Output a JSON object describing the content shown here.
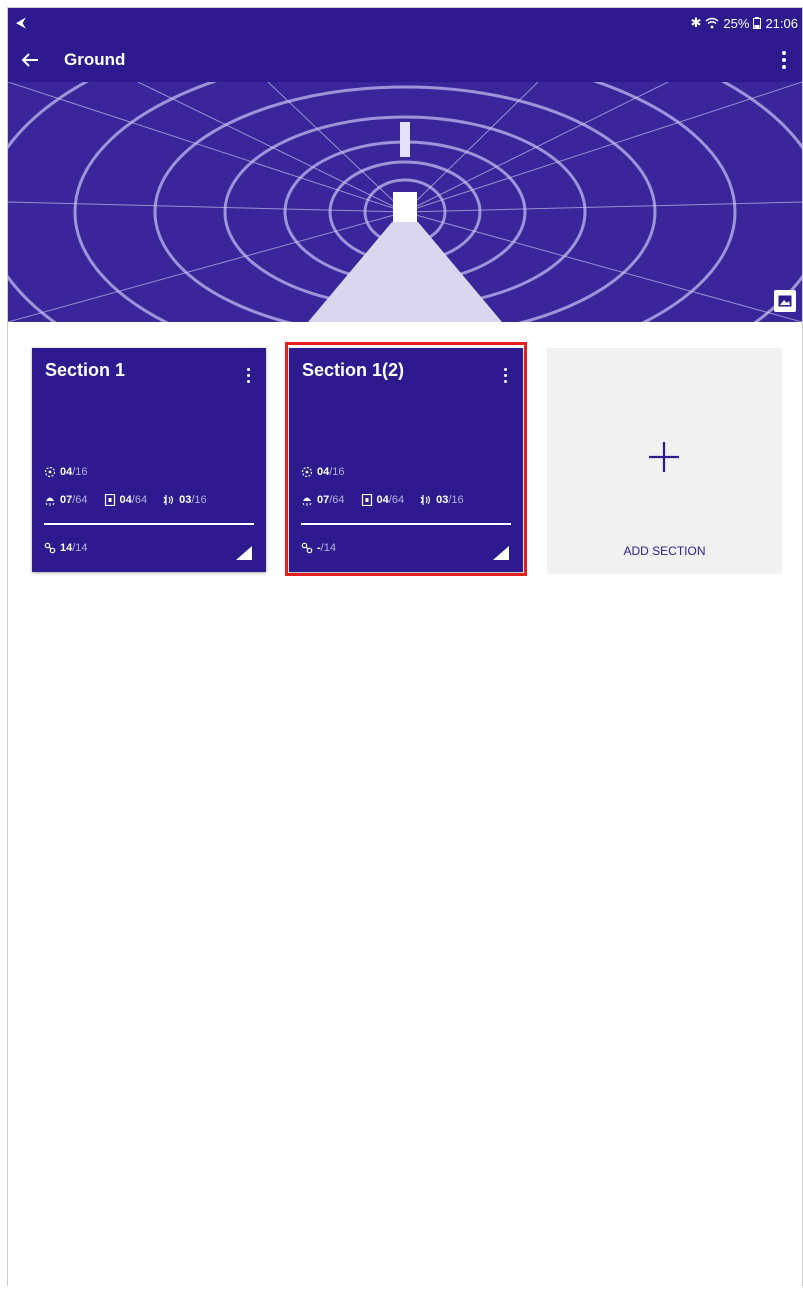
{
  "status_bar": {
    "battery": "25%",
    "time": "21:06"
  },
  "app_bar": {
    "title": "Ground"
  },
  "sections": [
    {
      "title": "Section 1",
      "sensor": {
        "value": "04",
        "total": "/16"
      },
      "sirens": {
        "value": "07",
        "total": "/64"
      },
      "keypads": {
        "value": "04",
        "total": "/64"
      },
      "repeaters": {
        "value": "03",
        "total": "/16"
      },
      "links": {
        "value": "14",
        "total": "/14"
      }
    },
    {
      "title": "Section 1(2)",
      "sensor": {
        "value": "04",
        "total": "/16"
      },
      "sirens": {
        "value": "07",
        "total": "/64"
      },
      "keypads": {
        "value": "04",
        "total": "/64"
      },
      "repeaters": {
        "value": "03",
        "total": "/16"
      },
      "links": {
        "value": "-",
        "total": "/14"
      }
    }
  ],
  "add_section": {
    "label": "ADD SECTION"
  },
  "colors": {
    "primary": "#2e1a8e",
    "highlight": "#e21f1f",
    "add_card_bg": "#f1f1f1"
  }
}
